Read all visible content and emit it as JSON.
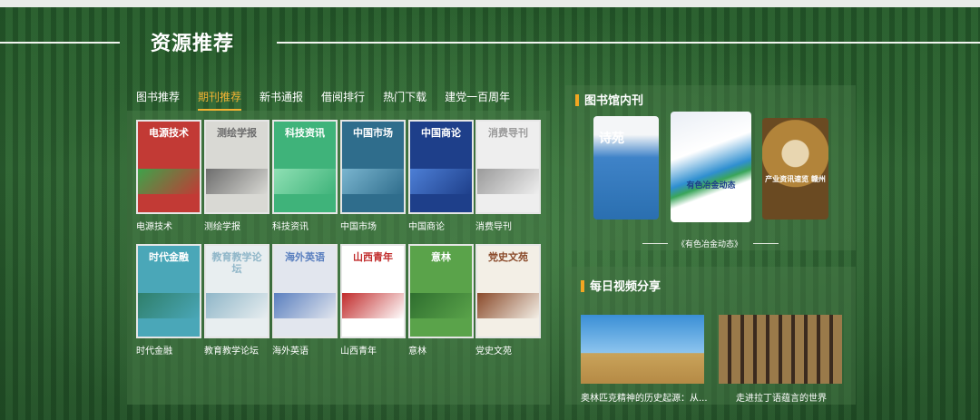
{
  "section": {
    "title": "资源推荐"
  },
  "tabs": [
    {
      "label": "图书推荐",
      "active": false
    },
    {
      "label": "期刊推荐",
      "active": true
    },
    {
      "label": "新书通报",
      "active": false
    },
    {
      "label": "借阅排行",
      "active": false
    },
    {
      "label": "热门下载",
      "active": false
    },
    {
      "label": "建党一百周年",
      "active": false
    }
  ],
  "journals": [
    {
      "label": "电源技术",
      "cover_text": "电源技术",
      "cover_color": "#c23a35",
      "accent": "#3ea34a"
    },
    {
      "label": "测绘学报",
      "cover_text": "测绘学报",
      "cover_color": "#d9d9d4",
      "accent": "#6d6d6d"
    },
    {
      "label": "科技资讯",
      "cover_text": "科技资讯",
      "cover_color": "#3fb37a",
      "accent": "#8fe0b4"
    },
    {
      "label": "中国市场",
      "cover_text": "中国市场",
      "cover_color": "#2f6d8c",
      "accent": "#7ab5cf"
    },
    {
      "label": "中国商论",
      "cover_text": "中国商论",
      "cover_color": "#1e3f8a",
      "accent": "#4d7fd6"
    },
    {
      "label": "消费导刊",
      "cover_text": "消费导刊",
      "cover_color": "#eeeeee",
      "accent": "#9a9a9a"
    },
    {
      "label": "时代金融",
      "cover_text": "时代金融",
      "cover_color": "#4aa7b8",
      "accent": "#2f7f6a"
    },
    {
      "label": "教育教学论坛",
      "cover_text": "教育教学论坛",
      "cover_color": "#e8eef0",
      "accent": "#8fb6c8"
    },
    {
      "label": "海外英语",
      "cover_text": "海外英语",
      "cover_color": "#e2e6ee",
      "accent": "#5a7fbf"
    },
    {
      "label": "山西青年",
      "cover_text": "山西青年",
      "cover_color": "#ffffff",
      "accent": "#c12b2b"
    },
    {
      "label": "意林",
      "cover_text": "意林",
      "cover_color": "#5aa34a",
      "accent": "#2f6f2f"
    },
    {
      "label": "党史文苑",
      "cover_text": "党史文苑",
      "cover_color": "#f3efe6",
      "accent": "#8a4a2a"
    }
  ],
  "library_journals": {
    "heading": "图书馆内刊",
    "caption": "《有色冶金动态》",
    "items": [
      {
        "cover_text": "诗苑",
        "cover_color": "#3f83c8"
      },
      {
        "cover_text": "有色冶金动态",
        "cover_color": "#e9eef5"
      },
      {
        "cover_text": "产业资讯速览 赣州",
        "cover_color": "#b2843a"
      }
    ]
  },
  "videos": {
    "heading": "每日视频分享",
    "items": [
      {
        "label": "奥林匹克精神的历史起源：从...",
        "sky": "#3a8fd6",
        "ground": "#c9a35a"
      },
      {
        "label": "走进拉丁语蕴言的世界",
        "sky": "#3b2a1e",
        "ground": "#9a7a4a"
      }
    ]
  }
}
